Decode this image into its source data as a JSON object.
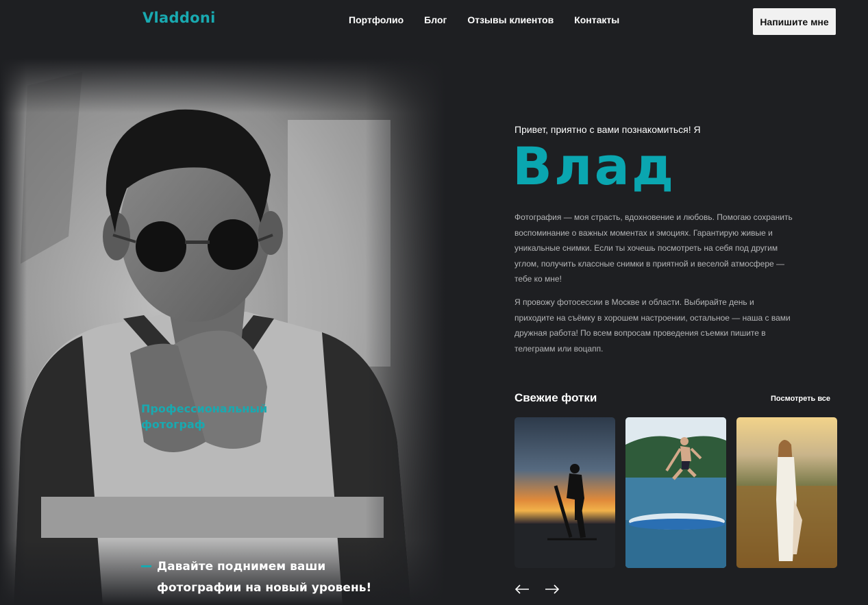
{
  "header": {
    "logo": "Vladdoni",
    "nav": [
      "Портфолио",
      "Блог",
      "Отзывы клиентов",
      "Контакты"
    ],
    "cta_label": "Напишите мне"
  },
  "hero": {
    "photo": "portrait-black-and-white",
    "pro_label": "Профессиональный фотограф",
    "tagline": "Давайте поднимем ваши фотографии на новый уровень!"
  },
  "intro": {
    "greeting": "Привет, приятно с вами познакомиться! Я",
    "name": "Влад",
    "bio_1": "Фотография — моя страсть, вдохновение и любовь. Помогаю сохранить воспоминание о важных моментах и эмоциях. Гарантирую живые и уникальные снимки. Если ты хочешь посмотреть на себя под другим углом, получить классные снимки в приятной и веселой атмосфере — тебе ко мне!",
    "bio_2": "Я провожу фотосессии в Москве и области. Выбирайте день и приходите на съёмку в хорошем настроении, остальное — наша с вами дружная работа! По всем вопросам проведения съемки пишите в телеграмм или воцапп."
  },
  "fresh": {
    "title": "Свежие фотки",
    "see_all": "Посмотреть все",
    "thumbs": [
      "sunset-wakeboarder",
      "lake-jump-sup",
      "woman-in-field"
    ]
  },
  "colors": {
    "accent": "#19a9b0",
    "background": "#1e1f22",
    "button_bg": "#f1f1f1",
    "body_text": "#b5b6b8"
  },
  "icons": [
    "arrow-left-icon",
    "arrow-right-icon"
  ]
}
